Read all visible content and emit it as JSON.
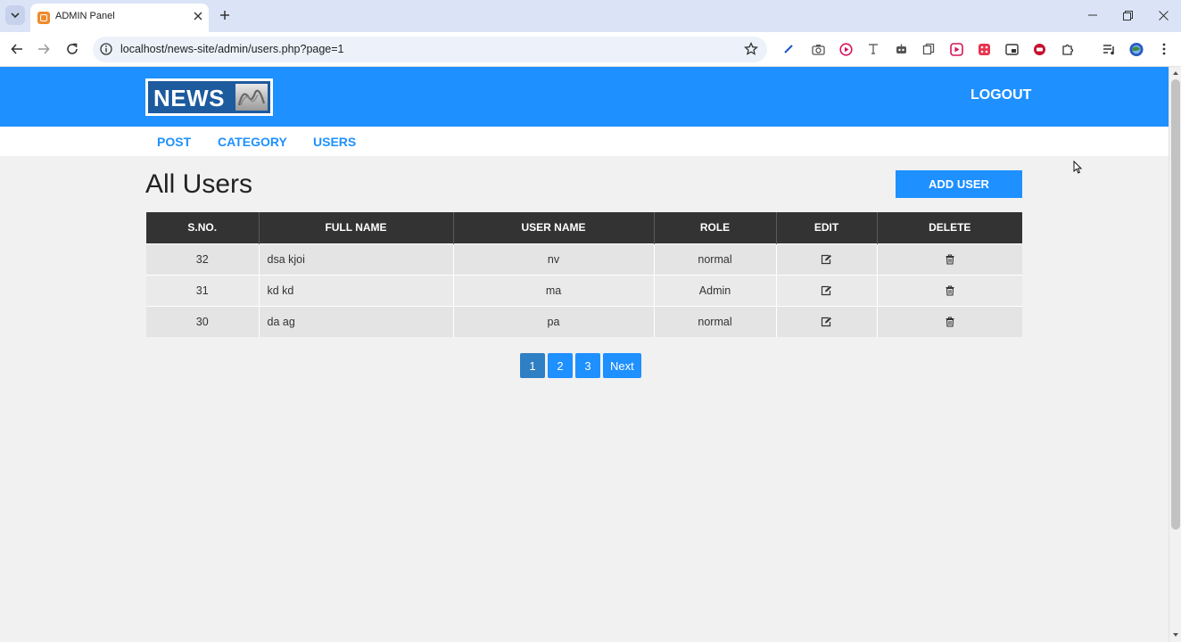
{
  "browser": {
    "tab_title": "ADMIN Panel",
    "url": "localhost/news-site/admin/users.php?page=1"
  },
  "header": {
    "logo_text": "NEWS",
    "logout_label": "LOGOUT"
  },
  "menu": {
    "items": [
      "POST",
      "CATEGORY",
      "USERS"
    ]
  },
  "main": {
    "title": "All Users",
    "add_user_label": "ADD USER"
  },
  "table": {
    "headers": [
      "S.NO.",
      "FULL NAME",
      "USER NAME",
      "ROLE",
      "EDIT",
      "DELETE"
    ],
    "rows": [
      {
        "sno": "32",
        "full_name": "dsa kjoi",
        "user_name": "nv",
        "role": "normal"
      },
      {
        "sno": "31",
        "full_name": "kd kd",
        "user_name": "ma",
        "role": "Admin"
      },
      {
        "sno": "30",
        "full_name": "da ag",
        "user_name": "pa",
        "role": "normal"
      }
    ]
  },
  "pagination": {
    "pages": [
      "1",
      "2",
      "3"
    ],
    "next_label": "Next",
    "current_page": "1"
  },
  "colors": {
    "primary": "#1e90ff",
    "table_header": "#333333",
    "active_page": "#2f7fc4"
  }
}
